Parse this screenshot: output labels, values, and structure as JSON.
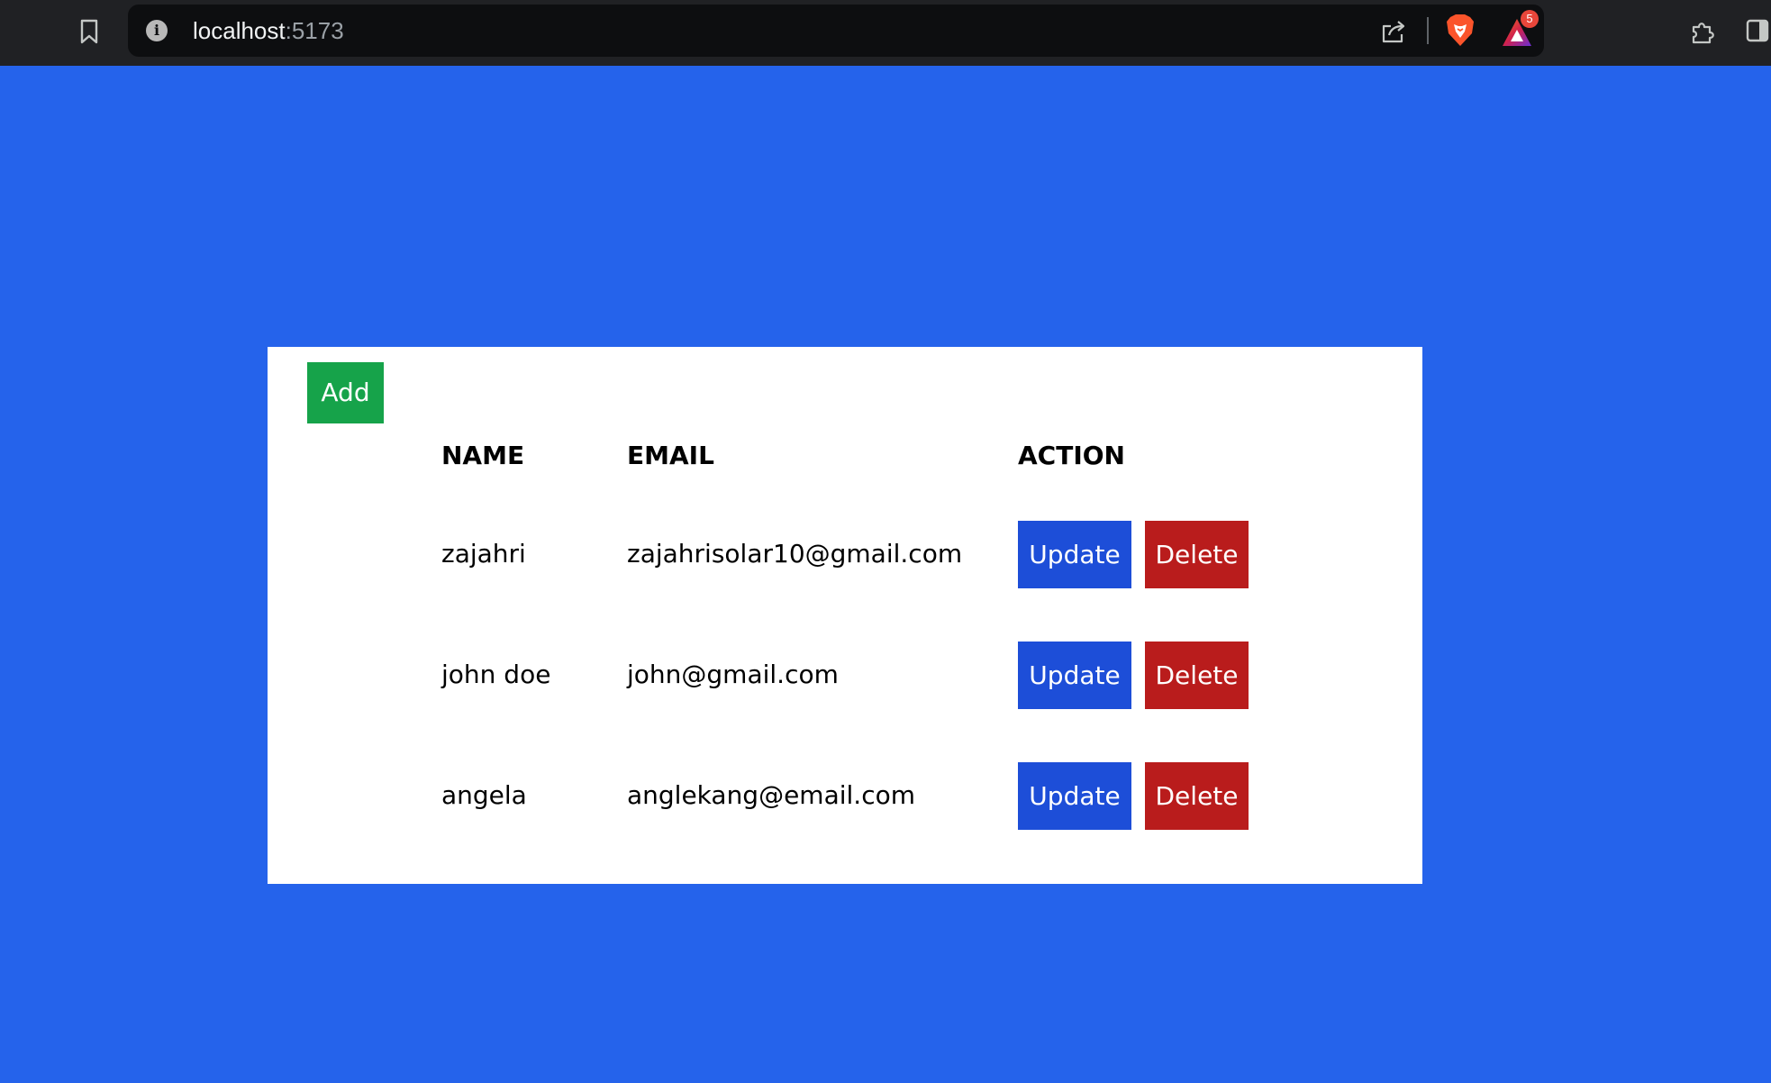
{
  "browser": {
    "url_host": "localhost",
    "url_port": ":5173",
    "info_glyph": "i",
    "icons": [
      "bookmark-icon",
      "info-icon",
      "share-icon",
      "brave-shields-icon",
      "brave-rewards-icon",
      "extensions-icon",
      "sidebar-icon"
    ],
    "rewards_badge_count": "5"
  },
  "page": {
    "background_color": "#2563eb",
    "add_button_label": "Add",
    "headers": {
      "name": "NAME",
      "email": "EMAIL",
      "action": "ACTION"
    },
    "users": [
      {
        "name": "zajahri",
        "email": "zajahrisolar10@gmail.com",
        "update_label": "Update",
        "delete_label": "Delete"
      },
      {
        "name": "john doe",
        "email": "john@gmail.com",
        "update_label": "Update",
        "delete_label": "Delete"
      },
      {
        "name": "angela",
        "email": "anglekang@email.com",
        "update_label": "Update",
        "delete_label": "Delete"
      }
    ],
    "colors": {
      "add": "#16a34a",
      "update": "#1d4ed8",
      "delete": "#b91c1c"
    }
  }
}
